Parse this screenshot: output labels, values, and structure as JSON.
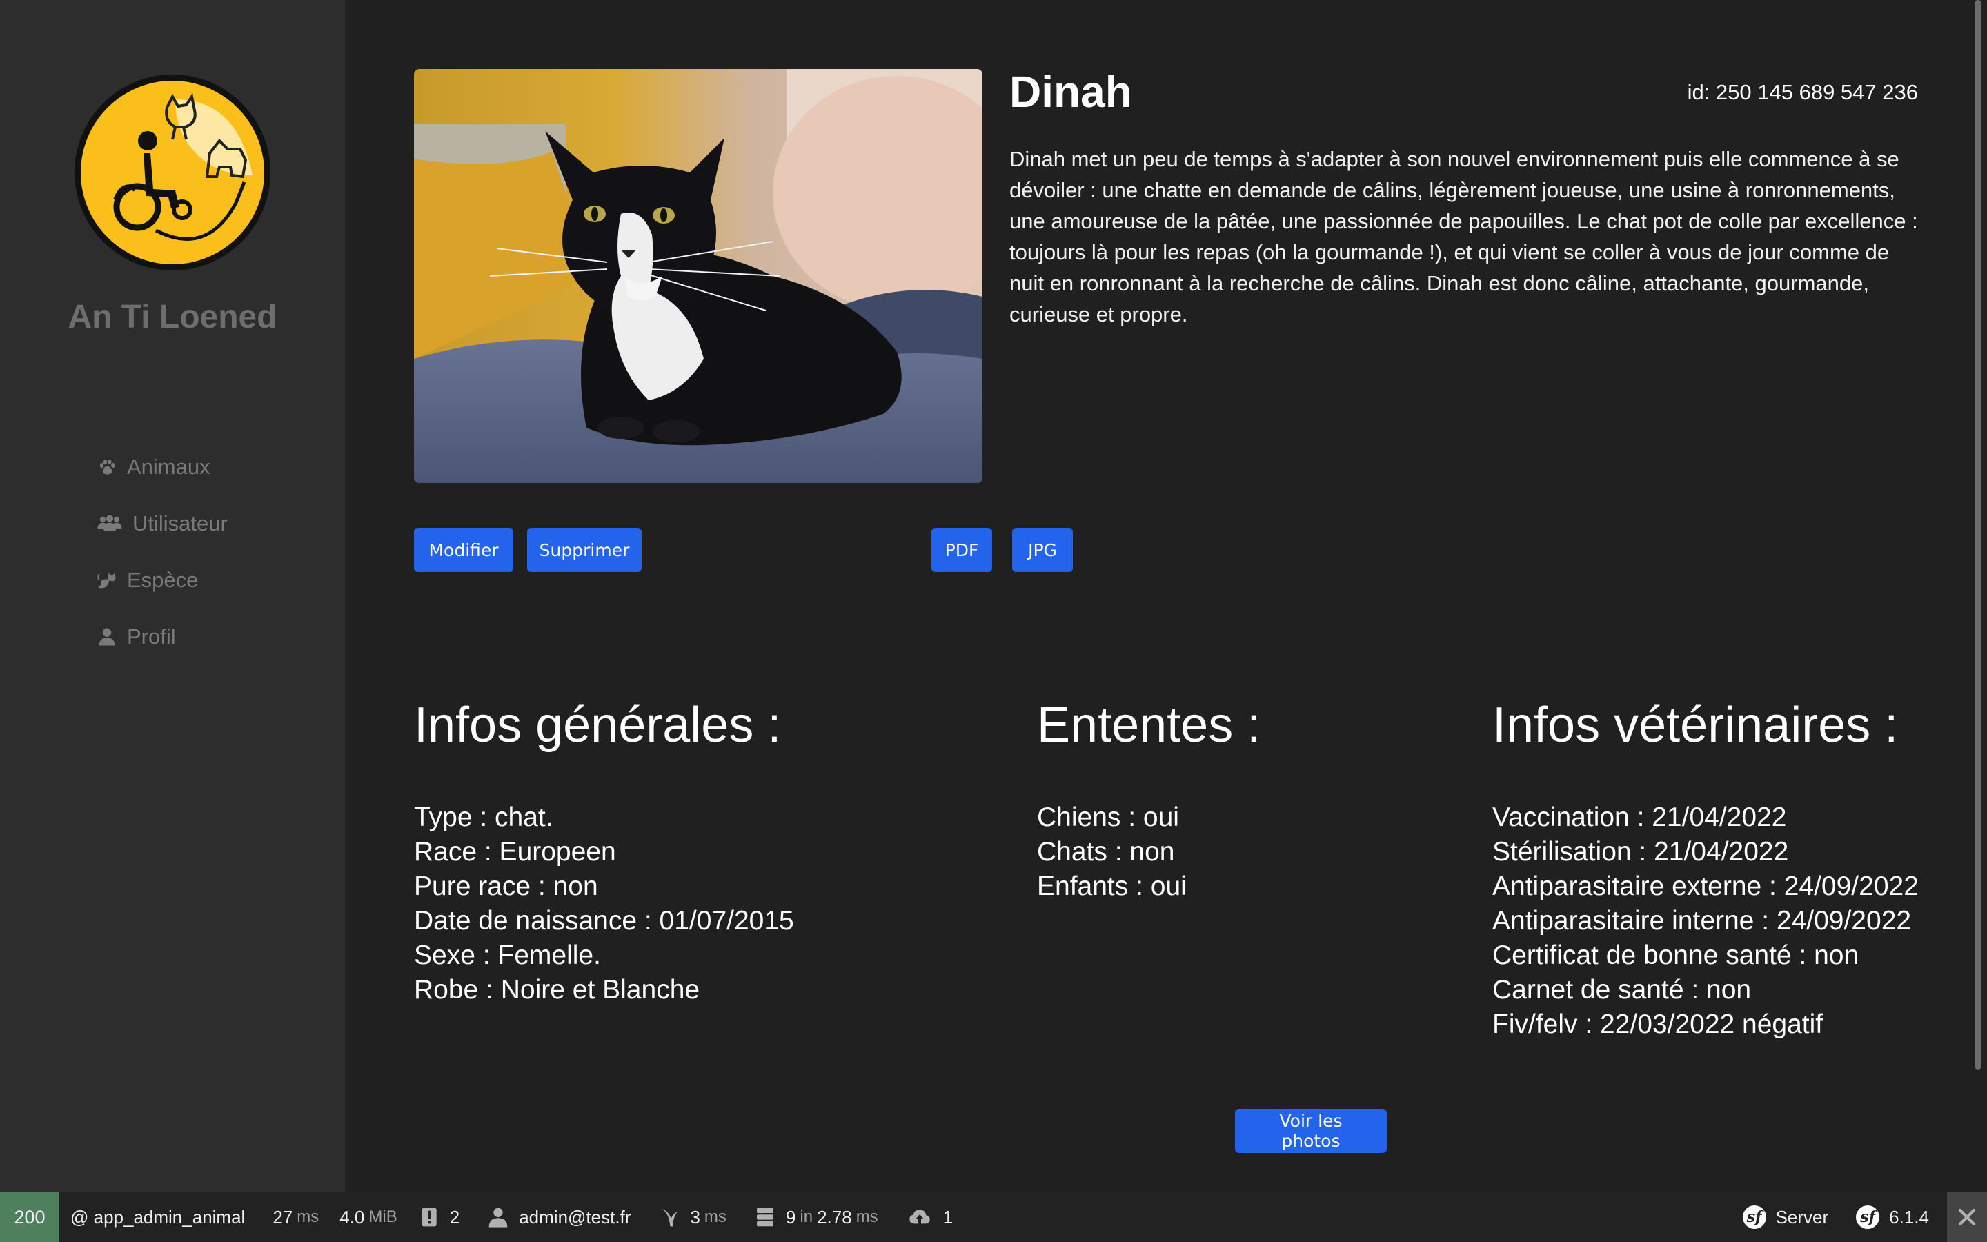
{
  "sidebar": {
    "app_name": "An Ti Loened",
    "nav": [
      {
        "label": "Animaux",
        "icon": "paw-icon"
      },
      {
        "label": "Utilisateur",
        "icon": "users-icon"
      },
      {
        "label": "Espèce",
        "icon": "cat-icon"
      },
      {
        "label": "Profil",
        "icon": "user-icon"
      }
    ]
  },
  "animal": {
    "name": "Dinah",
    "id_text": "id: 250 145 689 547 236",
    "description": "Dinah met un peu de temps à s'adapter à son nouvel environnement puis elle commence à se dévoiler : une chatte en demande de câlins, légèrement joueuse, une usine à ronronnements, une amoureuse de la pâtée, une passionnée de papouilles. Le chat pot de colle par excellence : toujours là pour les repas (oh la gourmande !), et qui vient se coller à vous de jour comme de nuit en ronronnant à la recherche de câlins. Dinah est donc câline, attachante, gourmande, curieuse et propre."
  },
  "actions": {
    "edit": "Modifier",
    "delete": "Supprimer",
    "pdf": "PDF",
    "jpg": "JPG",
    "photos": "Voir les photos"
  },
  "sections": {
    "general": {
      "title": "Infos générales :",
      "items": [
        "Type : chat.",
        "Race : Europeen",
        "Pure race : non",
        "Date de naissance : 01/07/2015",
        "Sexe : Femelle.",
        "Robe : Noire et Blanche"
      ]
    },
    "ententes": {
      "title": "Ententes :",
      "items": [
        "Chiens : oui",
        "Chats : non",
        "Enfants : oui"
      ]
    },
    "vet": {
      "title": "Infos vétérinaires :",
      "items": [
        "Vaccination : 21/04/2022",
        "Stérilisation : 21/04/2022",
        "Antiparasitaire externe : 24/09/2022",
        "Antiparasitaire interne : 24/09/2022",
        "Certificat de bonne santé : non",
        "Carnet de santé : non",
        "Fiv/felv : 22/03/2022 négatif"
      ]
    }
  },
  "toolbar": {
    "status": "200",
    "route": "@ app_admin_animal",
    "time_value": "27",
    "time_unit": "ms",
    "memory_value": "4.0",
    "memory_unit": "MiB",
    "logs_count": "2",
    "user": "admin@test.fr",
    "twig_value": "3",
    "twig_unit": "ms",
    "db_queries": "9",
    "db_in": "in",
    "db_time": "2.78",
    "db_unit": "ms",
    "cache_count": "1",
    "server_label": "Server",
    "symfony_version": "6.1.4"
  },
  "colors": {
    "background": "#202020",
    "sidebar": "#2d2d2d",
    "button": "#2463eb",
    "logo_yellow": "#fbbf1c",
    "status_ok": "#4f805d"
  }
}
